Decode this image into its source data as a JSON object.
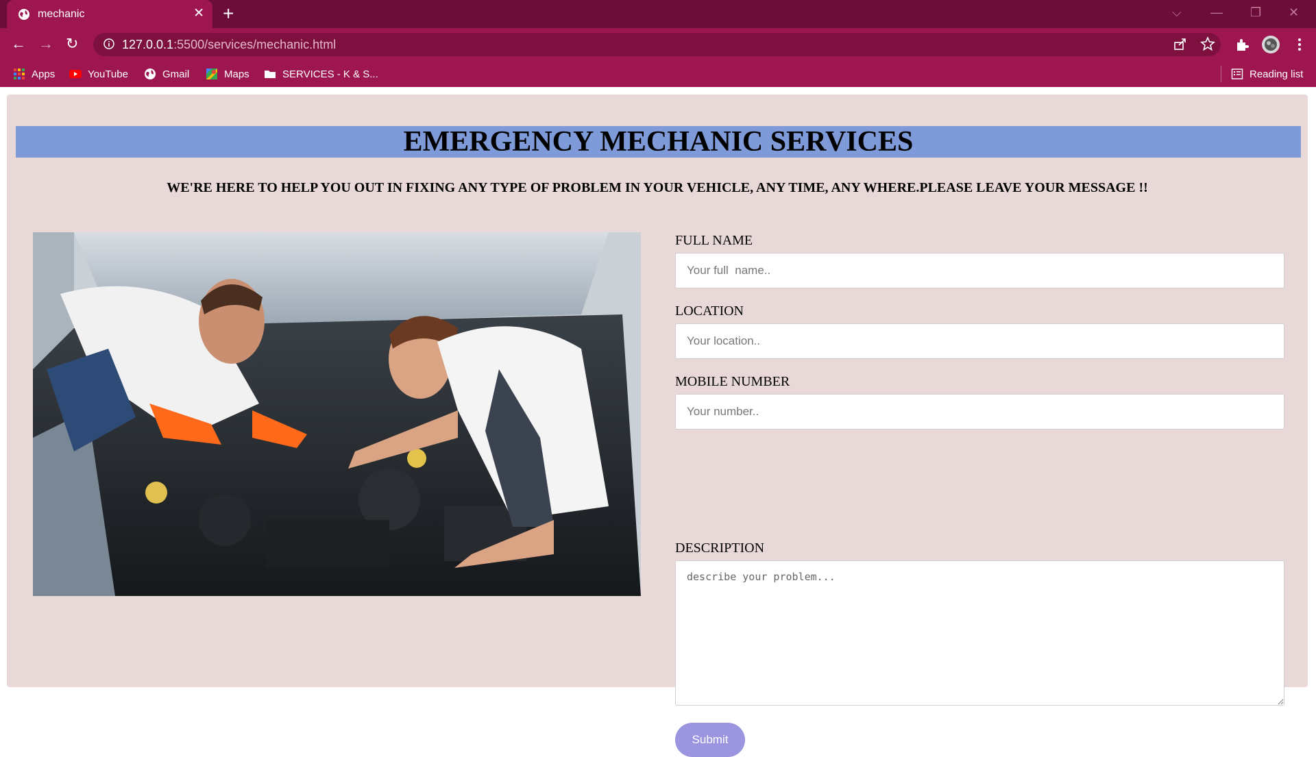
{
  "browser": {
    "tab": {
      "title": "mechanic",
      "close_glyph": "✕",
      "favicon": "globe-icon"
    },
    "new_tab_glyph": "+",
    "window_controls": {
      "tab_search": "⌵",
      "minimize": "—",
      "restore": "❐",
      "close": "✕"
    },
    "nav": {
      "back": "←",
      "forward": "→",
      "reload": "↻"
    },
    "address": {
      "host": "127.0.0.1",
      "path": ":5500/services/mechanic.html"
    },
    "bookmarks": [
      {
        "label": "Apps",
        "icon": "apps-grid-icon"
      },
      {
        "label": "YouTube",
        "icon": "youtube-icon"
      },
      {
        "label": "Gmail",
        "icon": "globe-icon"
      },
      {
        "label": "Maps",
        "icon": "maps-icon"
      },
      {
        "label": "SERVICES - K & S...",
        "icon": "folder-icon"
      }
    ],
    "reading_list": "Reading list"
  },
  "page": {
    "heading": "EMERGENCY MECHANIC SERVICES",
    "tagline": "WE'RE HERE TO HELP YOU OUT IN FIXING ANY TYPE OF PROBLEM IN YOUR VEHICLE, ANY TIME, ANY WHERE.PLEASE LEAVE YOUR MESSAGE !!",
    "image": {
      "subject": "two mechanics repairing a car engine"
    },
    "colors": {
      "banner": "#7f9ad8",
      "background": "#e8d9d8",
      "submit": "#9b94de",
      "chrome": "#9e1650"
    },
    "form": {
      "full_name": {
        "label": "FULL NAME",
        "placeholder": "Your full  name..",
        "value": ""
      },
      "location": {
        "label": "LOCATION",
        "placeholder": "Your location..",
        "value": ""
      },
      "mobile": {
        "label": "MOBILE NUMBER",
        "placeholder": "Your number..",
        "value": ""
      },
      "description": {
        "label": "DESCRIPTION",
        "placeholder": "describe your problem...",
        "value": ""
      },
      "submit_label": "Submit"
    }
  }
}
